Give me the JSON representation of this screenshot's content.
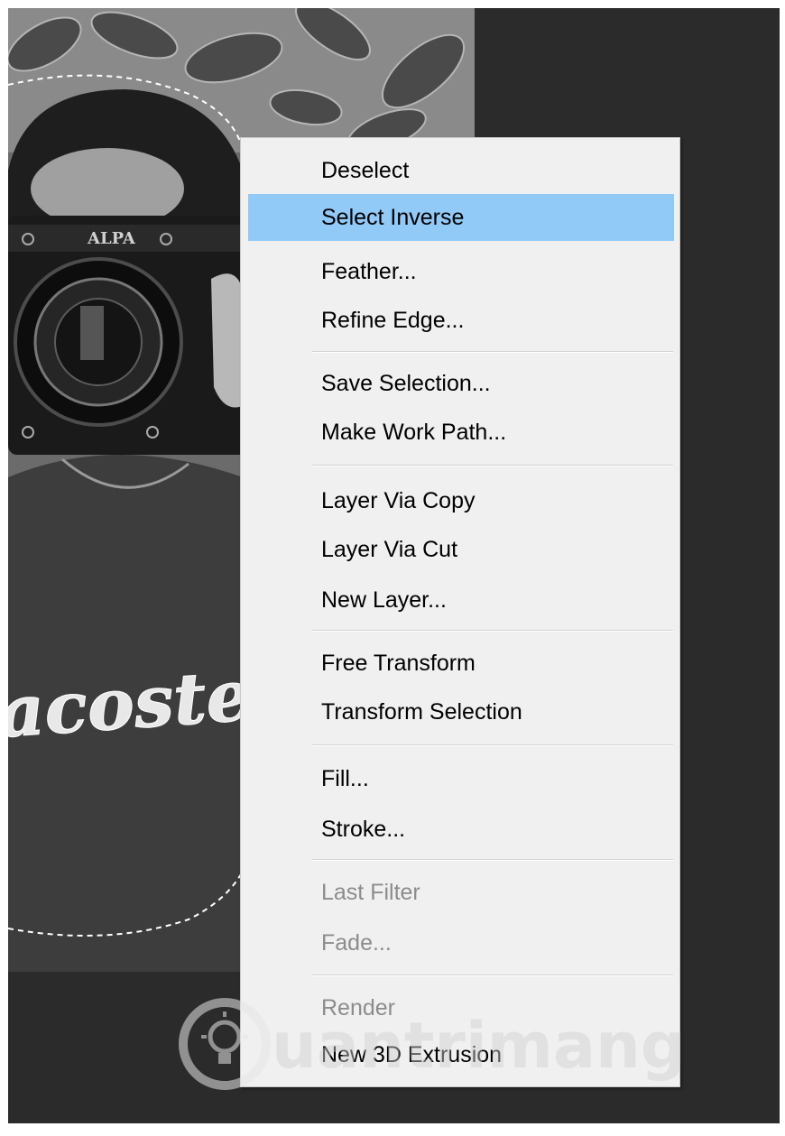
{
  "context_menu": {
    "items": [
      {
        "label": "Deselect",
        "state": "normal"
      },
      {
        "label": "Select Inverse",
        "state": "highlighted"
      },
      {
        "label": "Feather...",
        "state": "normal"
      },
      {
        "label": "Refine Edge...",
        "state": "normal"
      },
      {
        "label": "Save Selection...",
        "state": "normal"
      },
      {
        "label": "Make Work Path...",
        "state": "normal"
      },
      {
        "label": "Layer Via Copy",
        "state": "normal"
      },
      {
        "label": "Layer Via Cut",
        "state": "normal"
      },
      {
        "label": "New Layer...",
        "state": "normal"
      },
      {
        "label": "Free Transform",
        "state": "normal"
      },
      {
        "label": "Transform Selection",
        "state": "normal"
      },
      {
        "label": "Fill...",
        "state": "normal"
      },
      {
        "label": "Stroke...",
        "state": "normal"
      },
      {
        "label": "Last Filter",
        "state": "disabled"
      },
      {
        "label": "Fade...",
        "state": "disabled"
      },
      {
        "label": "Render",
        "state": "disabled"
      },
      {
        "label": "New 3D Extrusion",
        "state": "normal"
      }
    ],
    "highlight_color": "#91c9f7",
    "background_color": "#f0f0f0",
    "disabled_text_color": "#8c8c8c"
  },
  "photo": {
    "camera_brand": "ALPA",
    "shirt_text": "acoste"
  },
  "watermark": {
    "text": "uantrimang",
    "icon": "lightbulb-icon"
  }
}
